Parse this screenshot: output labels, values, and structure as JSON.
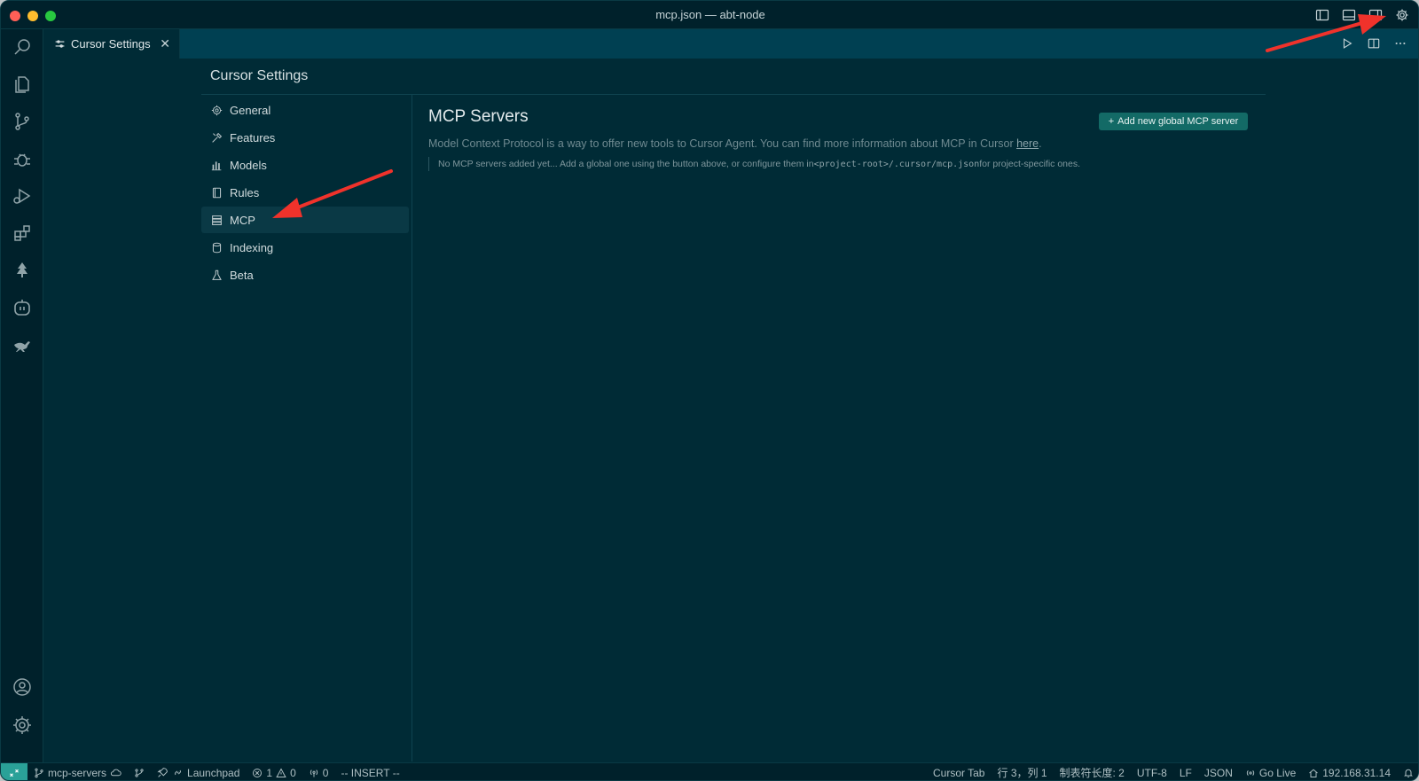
{
  "window": {
    "title": "mcp.json — abt-node"
  },
  "tab": {
    "label": "Cursor Settings",
    "close": "✕"
  },
  "settings": {
    "title": "Cursor Settings",
    "nav": [
      {
        "label": "General",
        "icon": "gear-icon",
        "active": false
      },
      {
        "label": "Features",
        "icon": "tools-icon",
        "active": false
      },
      {
        "label": "Models",
        "icon": "bar-chart-icon",
        "active": false
      },
      {
        "label": "Rules",
        "icon": "book-icon",
        "active": false
      },
      {
        "label": "MCP",
        "icon": "server-icon",
        "active": true
      },
      {
        "label": "Indexing",
        "icon": "database-icon",
        "active": false
      },
      {
        "label": "Beta",
        "icon": "flask-icon",
        "active": false
      }
    ]
  },
  "mcp": {
    "title": "MCP Servers",
    "description": "Model Context Protocol is a way to offer new tools to Cursor Agent. You can find more information about MCP in Cursor ",
    "link_text": "here",
    "description_end": ".",
    "notice_prefix": "No MCP servers added yet... Add a global one using the button above, or configure them in ",
    "notice_code": "<project-root>/.cursor/mcp.json",
    "notice_suffix": " for project-specific ones.",
    "add_button": "Add new global MCP server"
  },
  "statusbar": {
    "branch": "mcp-servers",
    "launchpad": "Launchpad",
    "errors": "1",
    "warnings": "0",
    "ports": "0",
    "mode": "-- INSERT --",
    "cursor_tab": "Cursor Tab",
    "position": "行 3，列 1",
    "tab_size": "制表符长度: 2",
    "encoding": "UTF-8",
    "eol": "LF",
    "language": "JSON",
    "go_live": "Go Live",
    "ip": "192.168.31.14"
  },
  "colors": {
    "background": "#002b36",
    "accent_button": "#136a66",
    "annotation_arrow": "#f0322b"
  }
}
